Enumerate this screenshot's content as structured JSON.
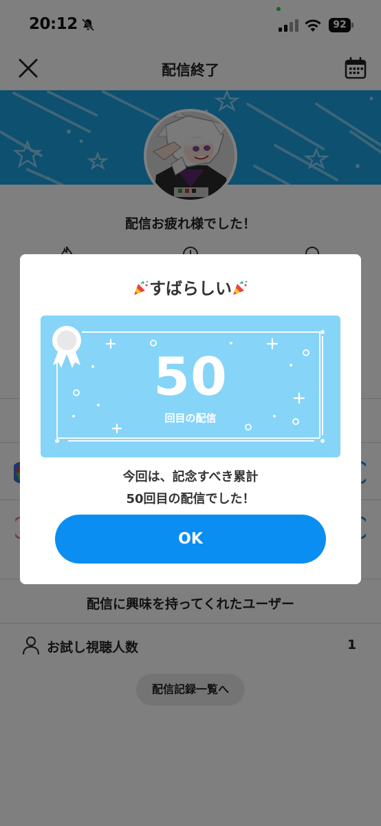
{
  "status_bar": {
    "time": "20:12",
    "battery": "92",
    "icons": [
      "bell-slash-icon",
      "signal-icon",
      "wifi-icon",
      "battery-icon"
    ]
  },
  "nav": {
    "title": "配信終了",
    "close_icon": "close-icon",
    "calendar_icon": "calendar-icon"
  },
  "background": {
    "thanks_message": "配信お疲れ様でした！",
    "stat_icons": [
      "flame-icon",
      "clock-icon",
      "search-icon"
    ],
    "interested_users_title": "配信に興味を持ってくれたユーザー",
    "trial_viewers": {
      "label": "お試し視聴人数",
      "value": "1"
    },
    "history_button": "配信記録一覧へ"
  },
  "modal": {
    "title": "すばらしい",
    "count": "50",
    "count_caption": "回目の配信",
    "message_line1": "今回は、記念すべき累計",
    "message_line2": "50回目の配信でした！",
    "ok_label": "OK"
  },
  "colors": {
    "banner_blue": "#1ba0e0",
    "card_blue": "#86d4f8",
    "ok_button_blue": "#0a8ef2",
    "overlay": "rgba(0,0,0,0.5)"
  }
}
